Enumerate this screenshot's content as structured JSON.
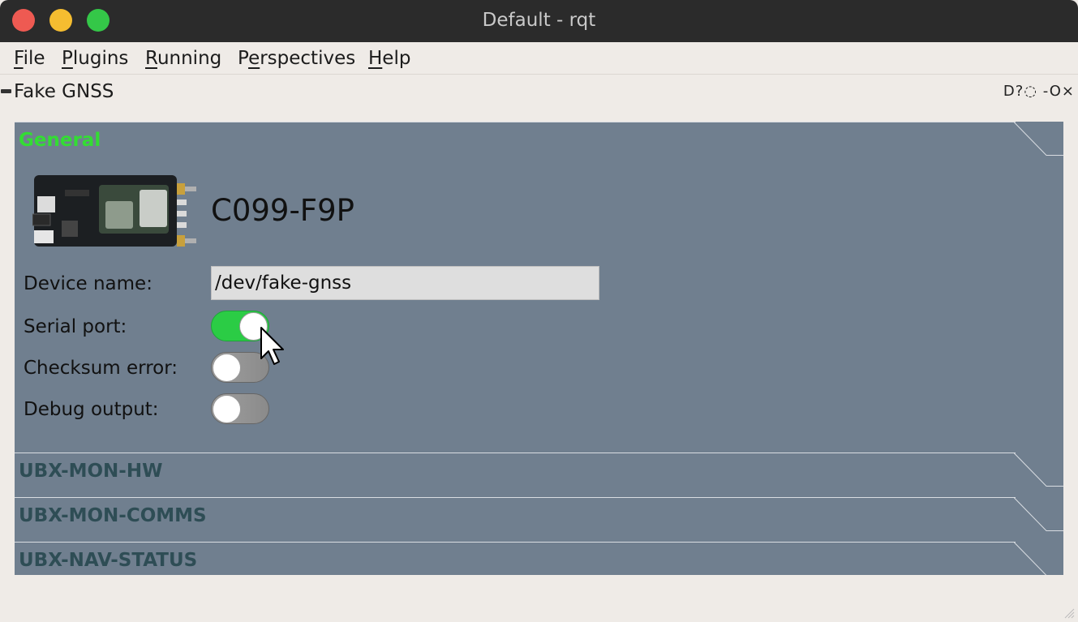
{
  "window": {
    "title": "Default - rqt"
  },
  "menubar": {
    "items": [
      {
        "mnemonic": "F",
        "rest": "ile"
      },
      {
        "mnemonic": "P",
        "rest": "lugins"
      },
      {
        "mnemonic": "R",
        "rest": "unning"
      },
      {
        "prefix": "P",
        "mnemonic": "e",
        "rest": "rspectives"
      },
      {
        "mnemonic": "H",
        "rest": "elp"
      }
    ]
  },
  "dock": {
    "title": "Fake GNSS",
    "controls": "D?◌ -O×"
  },
  "general": {
    "label": "General",
    "device_model": "C099-F9P",
    "device_name_label": "Device name:",
    "device_name_value": "/dev/fake-gnss",
    "serial_port_label": "Serial port:",
    "serial_port_on": true,
    "checksum_error_label": "Checksum error:",
    "checksum_error_on": false,
    "debug_output_label": "Debug output:",
    "debug_output_on": false
  },
  "sections": [
    {
      "label": "UBX-MON-HW"
    },
    {
      "label": "UBX-MON-COMMS"
    },
    {
      "label": "UBX-NAV-STATUS"
    }
  ],
  "colors": {
    "panel": "#707f8f",
    "active_section_label": "#33dd33",
    "inactive_section_label": "#2e4d55",
    "toggle_on": "#2bcc45"
  }
}
